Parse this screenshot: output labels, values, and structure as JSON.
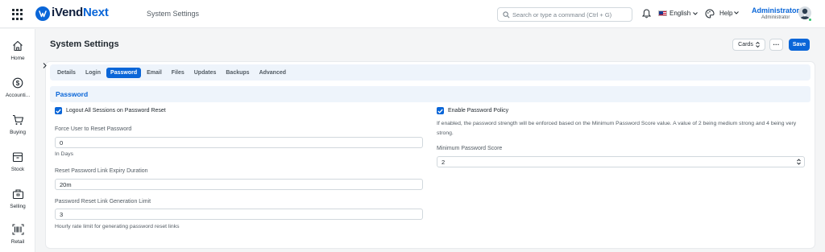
{
  "app": {
    "brand_prefix": "iVend",
    "brand_suffix": "Next",
    "page_header": "System Settings"
  },
  "topbar": {
    "search_placeholder": "Search or type a command (Ctrl + G)",
    "language": "English",
    "help": "Help",
    "user_name": "Administrator",
    "user_role": "Administrator"
  },
  "sidebar": {
    "items": [
      {
        "label": "Home",
        "icon": "home-icon"
      },
      {
        "label": "Accounti...",
        "icon": "dollar-icon"
      },
      {
        "label": "Buying",
        "icon": "cart-icon"
      },
      {
        "label": "Stock",
        "icon": "box-icon"
      },
      {
        "label": "Selling",
        "icon": "briefcase-icon"
      },
      {
        "label": "Retail",
        "icon": "barcode-icon"
      }
    ]
  },
  "page": {
    "title": "System Settings",
    "cards_label": "Cards",
    "more_label": "···",
    "save_label": "Save"
  },
  "tabs": [
    "Details",
    "Login",
    "Password",
    "Email",
    "Files",
    "Updates",
    "Backups",
    "Advanced"
  ],
  "active_tab": "Password",
  "section": {
    "title": "Password"
  },
  "form": {
    "logout_all": {
      "label": "Logout All Sessions on Password Reset",
      "checked": true
    },
    "force_reset": {
      "label": "Force User to Reset Password",
      "value": "0",
      "hint": "In Days"
    },
    "link_expiry": {
      "label": "Reset Password Link Expiry Duration",
      "value": "20m"
    },
    "gen_limit": {
      "label": "Password Reset Link Generation Limit",
      "value": "3",
      "hint": "Hourly rate limit for generating password reset links"
    },
    "enable_policy": {
      "label": "Enable Password Policy",
      "checked": true
    },
    "policy_hint_1": "If enabled, the password strength will be enforced based on the Minimum Password Score value. A value of 2 being medium strong and 4 being very",
    "policy_hint_2": "strong.",
    "min_score": {
      "label": "Minimum Password Score",
      "value": "2"
    }
  },
  "colors": {
    "primary": "#0a66d8",
    "section_bg": "#eef4fb",
    "border": "#d1d8dd",
    "online": "#2ec26b"
  }
}
